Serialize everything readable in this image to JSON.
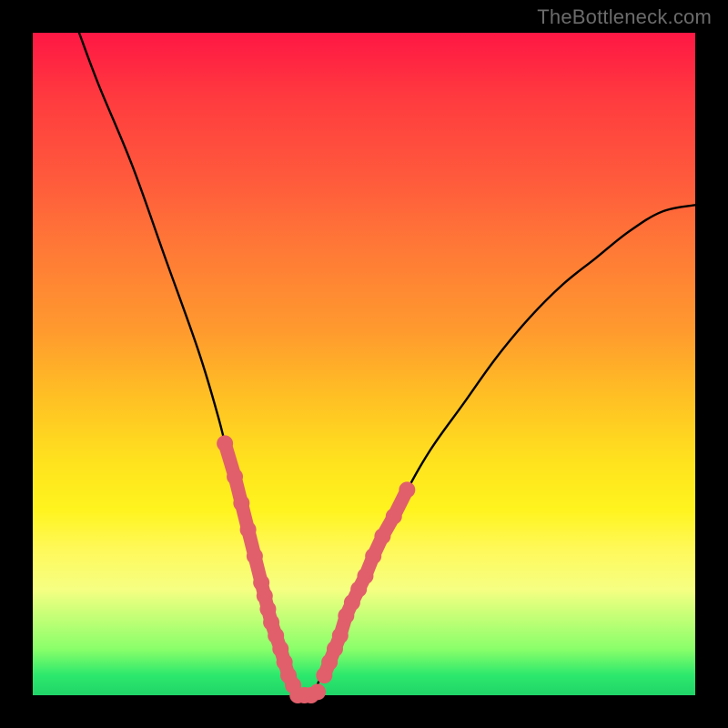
{
  "watermark": "TheBottleneck.com",
  "chart_data": {
    "type": "line",
    "title": "",
    "xlabel": "",
    "ylabel": "",
    "xlim": [
      0,
      100
    ],
    "ylim": [
      0,
      100
    ],
    "grid": false,
    "legend": false,
    "series": [
      {
        "name": "curve",
        "color": "#000000",
        "x": [
          7,
          10,
          15,
          20,
          25,
          28,
          30,
          32,
          34,
          36,
          37,
          38,
          39,
          40,
          42,
          44,
          46,
          48,
          52,
          56,
          60,
          65,
          70,
          75,
          80,
          85,
          90,
          95,
          100
        ],
        "values": [
          100,
          92,
          80,
          66,
          52,
          42,
          34,
          27,
          20,
          13,
          9,
          5,
          2,
          0,
          0,
          4,
          9,
          14,
          22,
          30,
          37,
          44,
          51,
          57,
          62,
          66,
          70,
          73,
          74
        ]
      },
      {
        "name": "markers-left",
        "type": "scatter",
        "color": "#E15F6B",
        "x": [
          29,
          30.5,
          31.5,
          32.5,
          33.5,
          34.5,
          35,
          35.5,
          36,
          36.7,
          37.4,
          38,
          38.6,
          39.3
        ],
        "values": [
          38,
          33,
          29,
          25,
          21,
          17,
          15,
          13,
          11,
          9,
          7,
          5,
          3,
          1.5
        ]
      },
      {
        "name": "markers-bottom",
        "type": "scatter",
        "color": "#E15F6B",
        "x": [
          40,
          41,
          42,
          43
        ],
        "values": [
          0,
          0,
          0,
          0.5
        ]
      },
      {
        "name": "markers-right",
        "type": "scatter",
        "color": "#E15F6B",
        "x": [
          44,
          44.8,
          45.6,
          46.4,
          47.3,
          48.2,
          49.2,
          50.2,
          51.4,
          52.8,
          54.5,
          56.5
        ],
        "values": [
          3,
          5,
          7,
          9,
          12,
          14,
          16,
          18,
          21,
          24,
          27,
          31
        ]
      }
    ]
  }
}
